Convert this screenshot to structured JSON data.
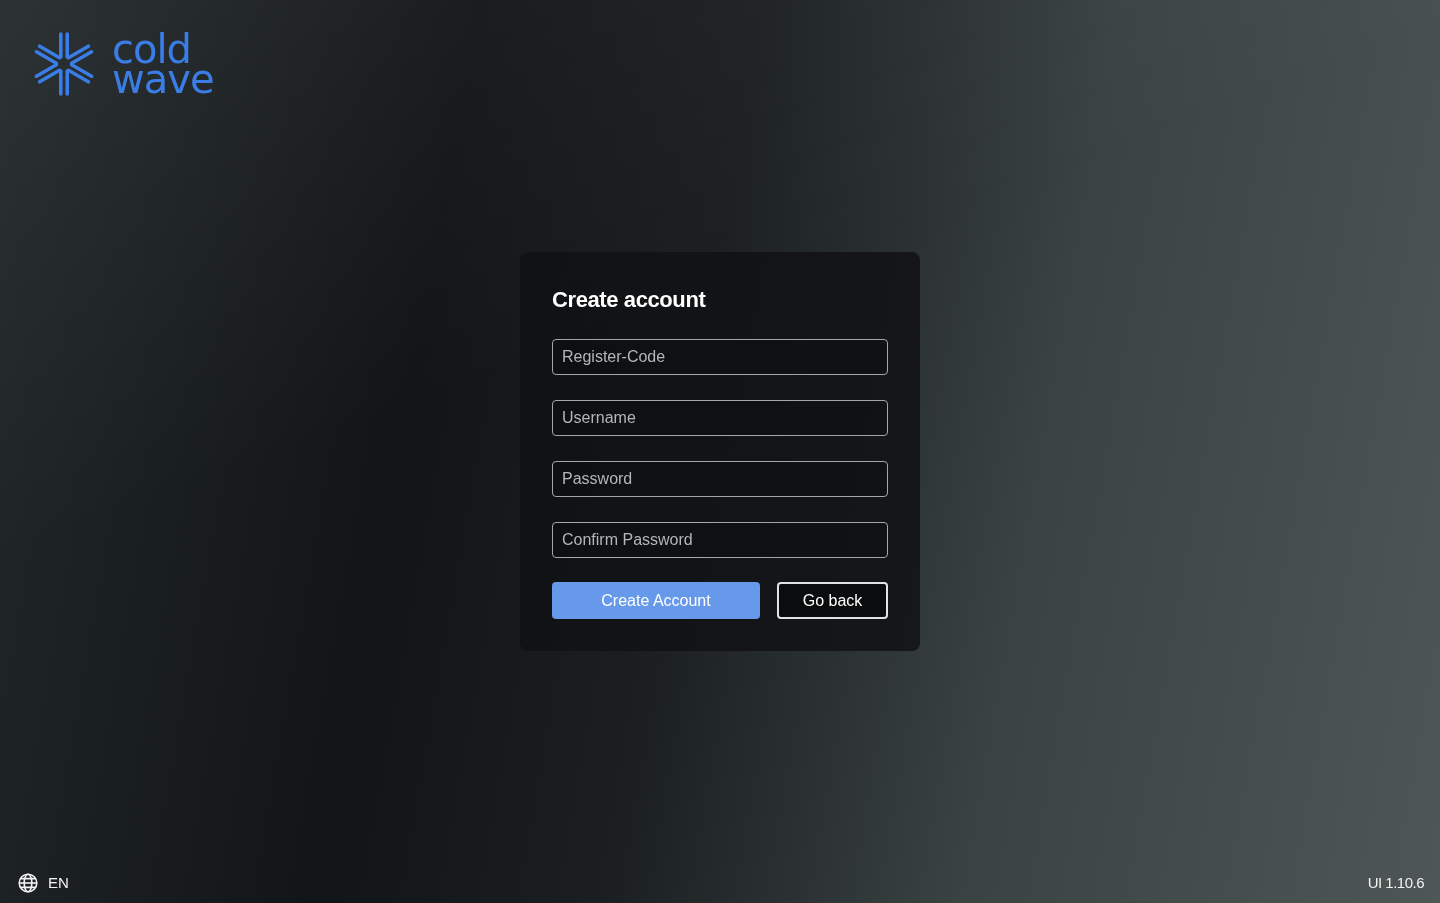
{
  "logo": {
    "lines": [
      "cold",
      "wave"
    ]
  },
  "form": {
    "title": "Create account",
    "fields": [
      {
        "placeholder": "Register-Code"
      },
      {
        "placeholder": "Username"
      },
      {
        "placeholder": "Password"
      },
      {
        "placeholder": "Confirm Password"
      }
    ],
    "buttons": [
      {
        "label": "Create Account",
        "kind": "primary"
      },
      {
        "label": "Go back",
        "kind": "secondary"
      }
    ]
  },
  "footer": {
    "language": "EN",
    "version": "UI 1.10.6"
  }
}
